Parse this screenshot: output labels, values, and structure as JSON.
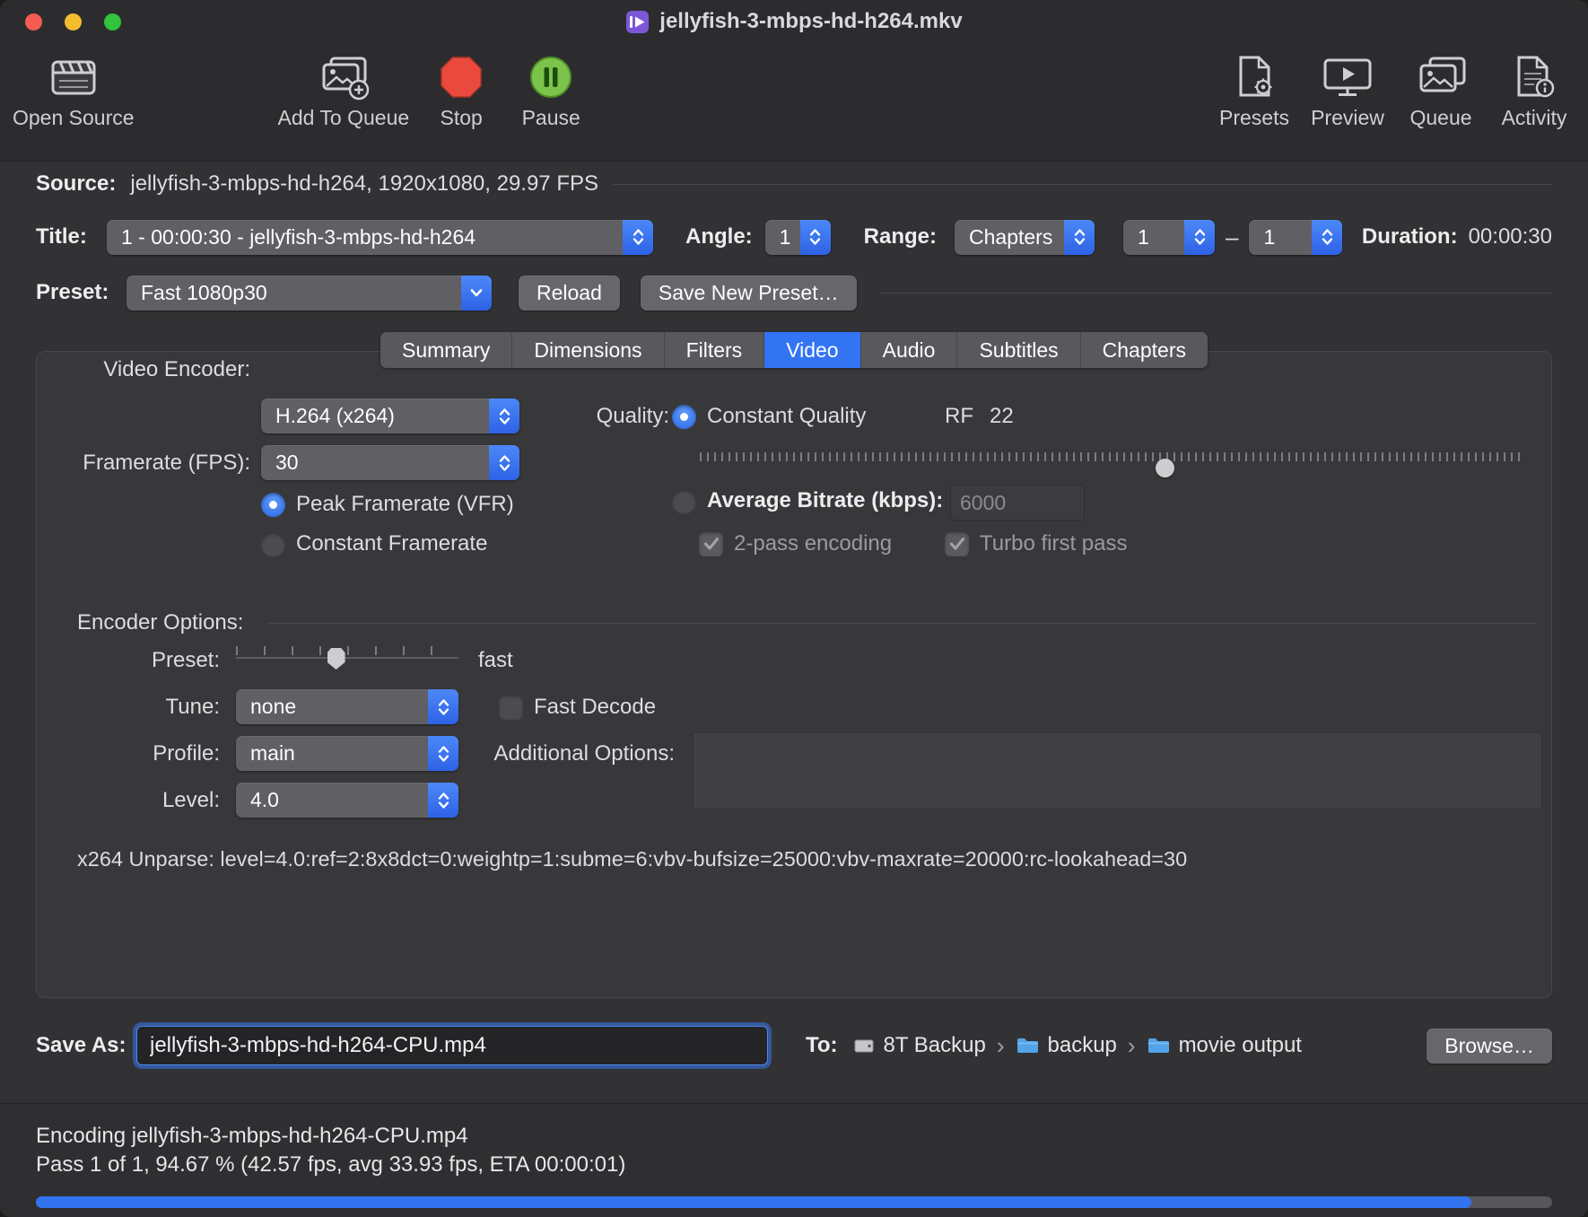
{
  "window": {
    "title": "jellyfish-3-mbps-hd-h264.mkv"
  },
  "toolbar": {
    "open_source": "Open Source",
    "add_to_queue": "Add To Queue",
    "stop": "Stop",
    "pause": "Pause",
    "presets": "Presets",
    "preview": "Preview",
    "queue": "Queue",
    "activity": "Activity"
  },
  "source": {
    "label": "Source:",
    "value": "jellyfish-3-mbps-hd-h264, 1920x1080, 29.97 FPS"
  },
  "title_row": {
    "title_label": "Title:",
    "title_value": "1 - 00:00:30 - jellyfish-3-mbps-hd-h264",
    "angle_label": "Angle:",
    "angle_value": "1",
    "range_label": "Range:",
    "range_value": "Chapters",
    "chapter_start": "1",
    "range_separator": "–",
    "chapter_end": "1",
    "duration_label": "Duration:",
    "duration_value": "00:00:30"
  },
  "preset_row": {
    "label": "Preset:",
    "value": "Fast 1080p30",
    "reload_button": "Reload",
    "save_new_preset_button": "Save New Preset…"
  },
  "tabs": [
    {
      "label": "Summary",
      "active": false
    },
    {
      "label": "Dimensions",
      "active": false
    },
    {
      "label": "Filters",
      "active": false
    },
    {
      "label": "Video",
      "active": true
    },
    {
      "label": "Audio",
      "active": false
    },
    {
      "label": "Subtitles",
      "active": false
    },
    {
      "label": "Chapters",
      "active": false
    }
  ],
  "video_tab": {
    "encoder_label": "Video Encoder:",
    "encoder_value": "H.264 (x264)",
    "framerate_label": "Framerate (FPS):",
    "framerate_value": "30",
    "peak_framerate_label": "Peak Framerate (VFR)",
    "peak_framerate_selected": true,
    "constant_framerate_label": "Constant Framerate",
    "constant_framerate_selected": false,
    "quality_label": "Quality:",
    "constant_quality_label": "Constant Quality",
    "constant_quality_selected": true,
    "rf_label": "RF",
    "rf_value": "22",
    "quality_slider_percent": 56.5,
    "average_bitrate_label": "Average Bitrate (kbps):",
    "average_bitrate_selected": false,
    "average_bitrate_value": "6000",
    "two_pass_label": "2-pass encoding",
    "two_pass_checked": true,
    "turbo_label": "Turbo first pass",
    "turbo_checked": true,
    "encoder_options_label": "Encoder Options:",
    "preset_label": "Preset:",
    "preset_value": "fast",
    "preset_slider_percent": 45,
    "tune_label": "Tune:",
    "tune_value": "none",
    "fast_decode_label": "Fast Decode",
    "fast_decode_checked": false,
    "profile_label": "Profile:",
    "profile_value": "main",
    "additional_options_label": "Additional Options:",
    "additional_options_value": "",
    "level_label": "Level:",
    "level_value": "4.0",
    "unparse_text": "x264 Unparse: level=4.0:ref=2:8x8dct=0:weightp=1:subme=6:vbv-bufsize=25000:vbv-maxrate=20000:rc-lookahead=30"
  },
  "save_row": {
    "save_as_label": "Save As:",
    "filename_value": "jellyfish-3-mbps-hd-h264-CPU.mp4",
    "to_label": "To:",
    "path": [
      {
        "name": "8T Backup",
        "icon": "drive-icon"
      },
      {
        "name": "backup",
        "icon": "folder-icon"
      },
      {
        "name": "movie output",
        "icon": "folder-icon"
      }
    ],
    "path_separator": "›",
    "browse_button": "Browse…"
  },
  "status": {
    "line1": "Encoding jellyfish-3-mbps-hd-h264-CPU.mp4",
    "line2": "Pass 1 of 1, 94.67 % (42.57 fps, avg 33.93 fps, ETA 00:00:01)",
    "progress_percent": 94.67
  },
  "colors": {
    "accent_blue": "#3374f3",
    "stop_red": "#ea4a3d",
    "pause_green": "#7cc34c",
    "folder_blue": "#53a4e8",
    "window_bg": "#323235",
    "panel_bg": "#38383b"
  }
}
